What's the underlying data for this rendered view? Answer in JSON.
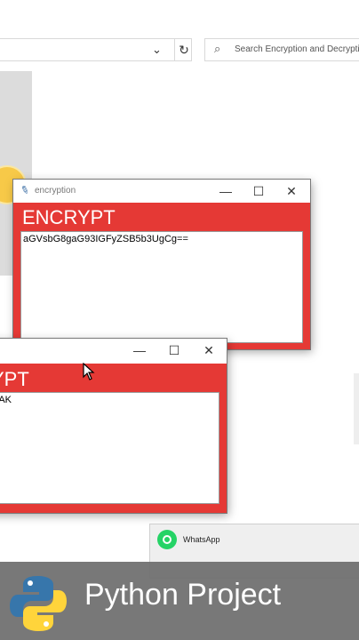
{
  "explorer": {
    "search_placeholder": "Search Encryption and Decryptic",
    "chevron": "⌄",
    "refresh": "↻"
  },
  "window_encrypt": {
    "title": "encryption",
    "heading": "ENCRYPT",
    "text": "aGVsbG8gaG93IGFyZSB5b3UgCg==",
    "controls": [
      "—",
      "☐",
      "✕"
    ]
  },
  "window_second": {
    "heading": "YPT",
    "text": "SAK",
    "controls": [
      "—",
      "☐",
      "✕"
    ]
  },
  "whatsapp": {
    "name": "WhatsApp"
  },
  "banner": {
    "text": "Python Project"
  },
  "colors": {
    "window_red": "#e53935",
    "banner_gray": "#6e6e6e",
    "whatsapp_green": "#25d366"
  }
}
